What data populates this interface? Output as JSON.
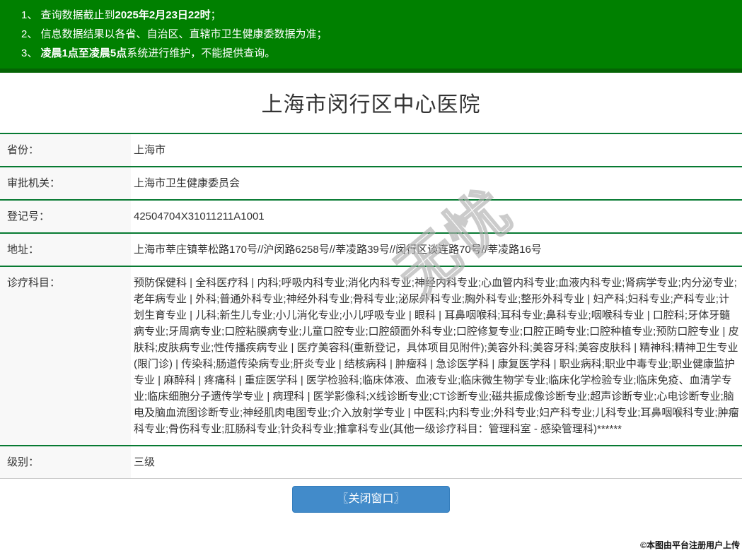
{
  "notice_banner": {
    "items": [
      {
        "prefix": "1、 查询数据截止到",
        "bold": "2025年2月23日22时",
        "suffix": "；"
      },
      {
        "prefix": "2、 信息数据结果以各省、自治区、直辖市卫生健康委数据为准；",
        "bold": "",
        "suffix": ""
      },
      {
        "prefix": "3、 ",
        "bold": "凌晨1点至凌晨5点",
        "suffix": "系统进行维护，不能提供查询。"
      }
    ]
  },
  "page_title": "上海市闵行区中心医院",
  "details": {
    "rows": [
      {
        "label": "省份：",
        "value": "上海市"
      },
      {
        "label": "审批机关：",
        "value": "上海市卫生健康委员会"
      },
      {
        "label": "登记号：",
        "value": "42504704X31011211A1001"
      },
      {
        "label": "地址：",
        "value": "上海市莘庄镇莘松路170号//沪闵路6258号//莘凌路39号//闵行区谈连路70号//莘凌路16号"
      },
      {
        "label": "诊疗科目：",
        "value": "预防保健科 | 全科医疗科 | 内科;呼吸内科专业;消化内科专业;神经内科专业;心血管内科专业;血液内科专业;肾病学专业;内分泌专业;老年病专业 | 外科;普通外科专业;神经外科专业;骨科专业;泌尿外科专业;胸外科专业;整形外科专业 | 妇产科;妇科专业;产科专业;计划生育专业 | 儿科;新生儿专业;小儿消化专业;小儿呼吸专业 | 眼科 | 耳鼻咽喉科;耳科专业;鼻科专业;咽喉科专业 | 口腔科;牙体牙髓病专业;牙周病专业;口腔粘膜病专业;儿童口腔专业;口腔颌面外科专业;口腔修复专业;口腔正畸专业;口腔种植专业;预防口腔专业 | 皮肤科;皮肤病专业;性传播疾病专业 | 医疗美容科(重新登记，具体项目见附件);美容外科;美容牙科;美容皮肤科 | 精神科;精神卫生专业(限门诊) | 传染科;肠道传染病专业;肝炎专业 | 结核病科 | 肿瘤科 | 急诊医学科 | 康复医学科 | 职业病科;职业中毒专业;职业健康监护专业 | 麻醉科 | 疼痛科 | 重症医学科 | 医学检验科;临床体液、血液专业;临床微生物学专业;临床化学检验专业;临床免疫、血清学专业;临床细胞分子遗传学专业 | 病理科 | 医学影像科;X线诊断专业;CT诊断专业;磁共振成像诊断专业;超声诊断专业;心电诊断专业;脑电及脑血流图诊断专业;神经肌肉电图专业;介入放射学专业 | 中医科;内科专业;外科专业;妇产科专业;儿科专业;耳鼻咽喉科专业;肿瘤科专业;骨伤科专业;肛肠科专业;针灸科专业;推拿科专业(其他一级诊疗科目：管理科室 - 感染管理科)******"
      },
      {
        "label": "级别：",
        "value": "三级"
      }
    ]
  },
  "close_button_label": "〖关闭窗口〗",
  "watermark_text": "无忧",
  "attribution_note": "©本图由平台注册用户上传",
  "colors": {
    "banner_green": "#008000",
    "banner_border_green": "#046404",
    "divider_green": "#077a32",
    "label_cell_bg": "#f8f8f8",
    "button_blue": "#428bca",
    "button_border_blue": "#357ebd",
    "title_text": "#333333"
  }
}
